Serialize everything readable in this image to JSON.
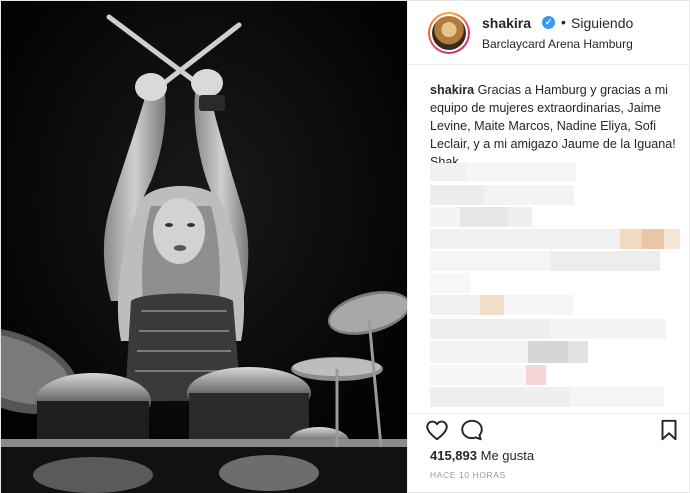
{
  "header": {
    "username": "shakira",
    "separator": "•",
    "follow_label": "Siguiendo",
    "location": "Barclaycard Arena Hamburg"
  },
  "caption": {
    "username": "shakira",
    "text": "Gracias a Hamburg y gracias a mi equipo de mujeres extraordinarias, Jaime Levine, Maite Marcos, Nadine Eliya, Sofi Leclair, y a mi amigazo Jaume de la Iguana! Shak"
  },
  "stats": {
    "likes_count": "415,893",
    "likes_label": "Me gusta",
    "timestamp": "HACE 10 HORAS"
  },
  "icons": {
    "like": "heart-icon",
    "comment": "comment-icon",
    "save": "bookmark-icon",
    "verified": "verified-icon"
  },
  "colors": {
    "verified_blue": "#3897f0",
    "text": "#262626",
    "muted": "#999999",
    "border": "#efefef",
    "photo_bg": "#050505"
  }
}
